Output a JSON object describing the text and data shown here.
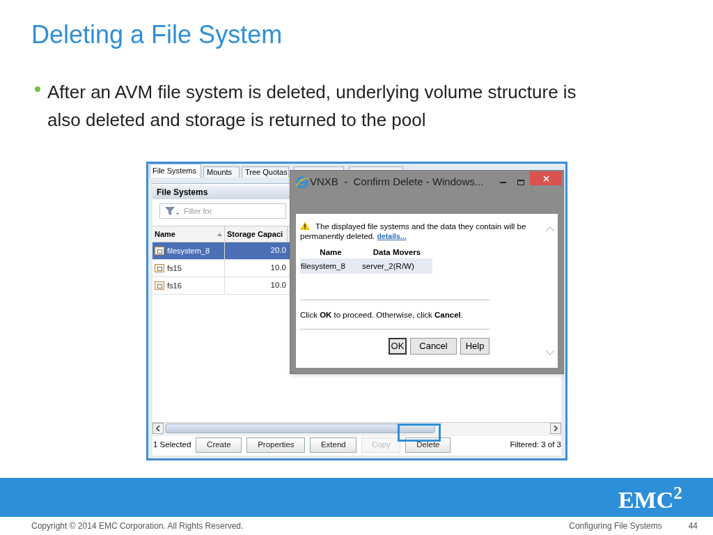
{
  "slide": {
    "title": "Deleting a File System",
    "bullets": [
      "After an AVM file system is deleted, underlying volume structure is also deleted and storage is returned to the pool"
    ]
  },
  "screenshot": {
    "tabs": [
      {
        "label": "File Systems",
        "selected": true
      },
      {
        "label": "Mounts",
        "selected": false
      },
      {
        "label": "Tree Quotas",
        "selected": false
      }
    ],
    "panel_title": "File Systems",
    "filter": {
      "placeholder": "Filter for"
    },
    "columns": [
      "Name",
      "Storage Capaci"
    ],
    "rows": [
      {
        "name": "filesystem_8",
        "capacity": "20.0",
        "selected": true
      },
      {
        "name": "fs15",
        "capacity": "10.0",
        "selected": false
      },
      {
        "name": "fs16",
        "capacity": "10.0",
        "selected": false
      }
    ],
    "selection_count": "1 Selected",
    "buttons": [
      {
        "label": "Create",
        "disabled": false
      },
      {
        "label": "Properties",
        "disabled": false
      },
      {
        "label": "Extend",
        "disabled": false
      },
      {
        "label": "Copy",
        "disabled": true
      },
      {
        "label": "Delete",
        "disabled": false
      }
    ],
    "filter_status": "Filtered: 3 of 3"
  },
  "dialog": {
    "title": "VNXB  -  Confirm Delete - Windows...",
    "message": "The displayed file systems and the data they contain will be permanently deleted.",
    "link": "details...",
    "columns": [
      "Name",
      "Data Movers"
    ],
    "rows": [
      [
        "filesystem_8",
        "server_2(R/W)"
      ]
    ],
    "instruction": "Click **OK** to proceed. Otherwise, click **Cancel**.",
    "buttons": [
      {
        "label": "OK",
        "focused": true
      },
      {
        "label": "Cancel",
        "focused": false
      },
      {
        "label": "Help",
        "focused": false
      }
    ]
  },
  "footer": {
    "logo": "EMC$^{2}$",
    "copyright": "Copyright © 2014 EMC Corporation. All Rights Reserved.",
    "section": "Configuring File Systems",
    "page": "44"
  }
}
